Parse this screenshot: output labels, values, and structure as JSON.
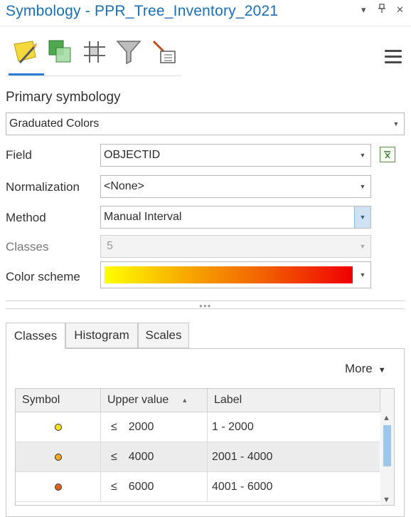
{
  "window": {
    "title": "Symbology - PPR_Tree_Inventory_2021",
    "dropdown_glyph": "▾",
    "pin_glyph": "📌",
    "close_glyph": "✕"
  },
  "toolbar": {
    "icons": [
      "primary-symbology-icon",
      "vary-symbology-icon",
      "symbol-layer-drawing-icon",
      "masking-icon",
      "display-filters-icon"
    ],
    "menu_icon": "hamburger-menu-icon"
  },
  "primary": {
    "heading": "Primary symbology",
    "renderer": "Graduated Colors",
    "field": {
      "label": "Field",
      "value": "OBJECTID"
    },
    "normalization": {
      "label": "Normalization",
      "value": "<None>"
    },
    "method": {
      "label": "Method",
      "value": "Manual Interval"
    },
    "classes": {
      "label": "Classes",
      "value": "5"
    },
    "color_scheme": {
      "label": "Color scheme",
      "ramp_colors": [
        "#ffff00",
        "#f7a800",
        "#f25a00",
        "#f00000"
      ]
    }
  },
  "tabs": {
    "classes": "Classes",
    "histogram": "Histogram",
    "scales": "Scales",
    "active": "Classes"
  },
  "classes_panel": {
    "more_label": "More",
    "columns": {
      "symbol": "Symbol",
      "upper": "Upper value",
      "label": "Label"
    },
    "rows": [
      {
        "op": "≤",
        "upper": "2000",
        "label": "1 - 2000",
        "color": "#f5e41c"
      },
      {
        "op": "≤",
        "upper": "4000",
        "label": "2001 - 4000",
        "color": "#f3a722"
      },
      {
        "op": "≤",
        "upper": "6000",
        "label": "4001 - 6000",
        "color": "#e0651c"
      }
    ]
  },
  "colors": {
    "accent": "#1b6fb5",
    "tab_underline": "#2a7fd4",
    "scroll_thumb": "#9fc7ea"
  }
}
